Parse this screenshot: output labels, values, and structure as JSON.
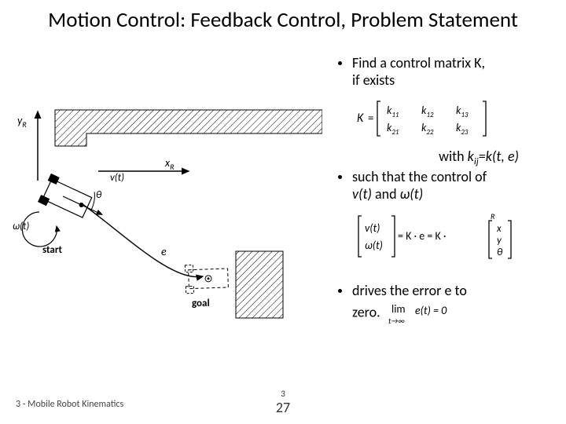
{
  "title": "Motion Control: Feedback Control, Problem Statement",
  "bullets": {
    "b1a": "Find a control matrix K,",
    "b1b": "if exists",
    "with_line_pre": "with ",
    "with_kij": "k",
    "with_ij": "ij",
    "with_rest": "=k(t, e)",
    "b2a": "such that the control of",
    "b2b_pre": "v(t)",
    "b2b_mid": " and ",
    "b2b_omega": "ω",
    "b2b_post": "(t)",
    "b3a": "drives the error e to",
    "b3b": "zero."
  },
  "matrix": {
    "Klabel": "K",
    "k11": "k",
    "s11": "11",
    "k12": "k",
    "s12": "12",
    "k13": "k",
    "s13": "13",
    "k21": "k",
    "s21": "21",
    "k22": "k",
    "s22": "22",
    "k23": "k",
    "s23": "23"
  },
  "control": {
    "v": "v(t)",
    "w": "ω(t)",
    "mid": " = K · e = K · ",
    "Rlabel": "R",
    "x": "x",
    "y": "y",
    "th": "θ"
  },
  "limit": {
    "lim": "lim",
    "sub": "t→∞",
    "body": "e(t) = 0"
  },
  "diagram": {
    "yR_y": "y",
    "yR_R": "R",
    "xR_x": "x",
    "xR_R": "R",
    "vt": "v(t)",
    "wt": "ω(t)",
    "theta": "θ",
    "e": "e",
    "start": "start",
    "goal": "goal"
  },
  "footer": {
    "left": "3 - Mobile Robot Kinematics",
    "small": "3",
    "page": "27"
  }
}
